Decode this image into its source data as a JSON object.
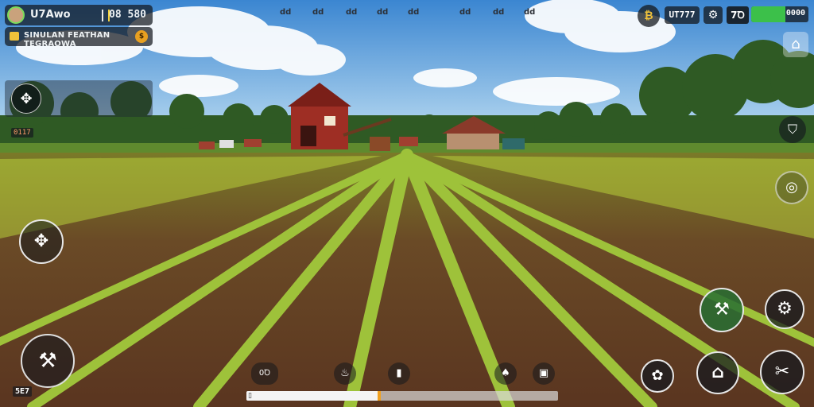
{
  "player": {
    "name": "U7Awo",
    "score": "08 580",
    "quest_title": "SINULAN FEATHAN TEGRAOWA",
    "quest_coin": "$",
    "map_tool_icon": "tractor-tool-icon",
    "resource_counter": "0117"
  },
  "top_indicators": [
    "dd",
    "dd",
    "dd",
    "dd",
    "dd",
    "dd",
    "dd",
    "dd"
  ],
  "top_right": {
    "coin_icon": "coin-icon",
    "coin_glyph": "₿",
    "money": "UT777",
    "gear_glyph": "⚙",
    "tool_label": "7Ꝺ",
    "energy_label": "0000",
    "energy_level": 0.6
  },
  "buttons": {
    "camera_glyph": "⌂",
    "map_glyph": "⛉",
    "compass_glyph": "◎",
    "joystick_top_glyph": "✥",
    "joystick_bottom_glyph": "⚒",
    "tool_green_glyph": "⚒",
    "settings_glyph": "⚙",
    "harvest_glyph": "✿",
    "silo_glyph": "⌂",
    "wrench_glyph": "✂"
  },
  "bottom_left_label": "5E7",
  "toolbar": {
    "slots": [
      "⚙",
      "♨",
      "▮",
      "♠",
      "▣"
    ],
    "slot_label_first": "0Ꝺ",
    "progress": 0.42,
    "progress_label": "▯"
  },
  "colors": {
    "sky_top": "#3f8fd6",
    "sky_bottom": "#b9dcf2",
    "soil": "#6a4226",
    "crop": "#8ebf2e",
    "barn": "#9e2e24",
    "energy": "#3cc04a"
  }
}
